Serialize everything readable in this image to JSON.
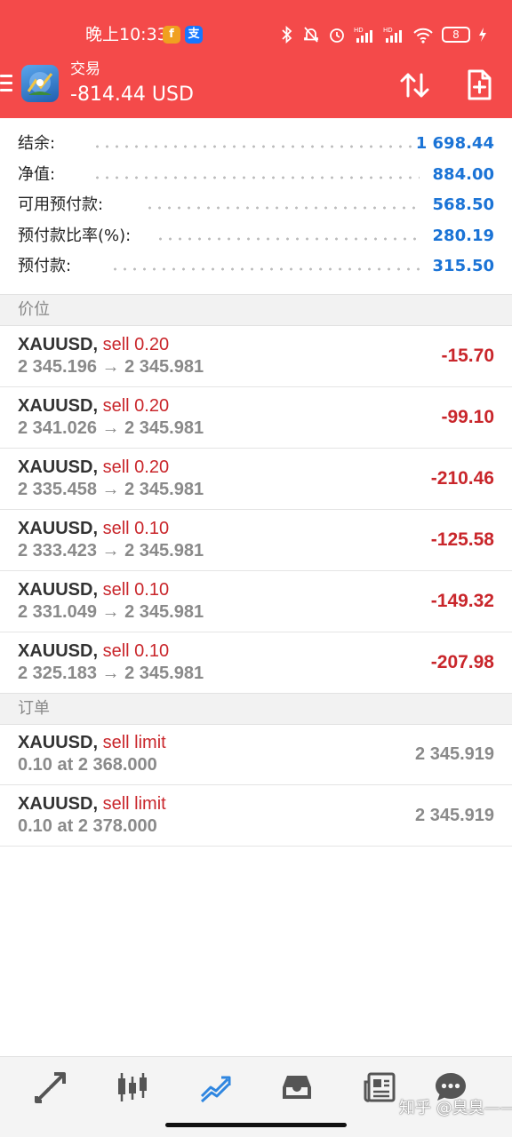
{
  "status_bar": {
    "time": "晚上10:33",
    "app_badges": [
      "f",
      "支"
    ],
    "battery": "8"
  },
  "header": {
    "title": "交易",
    "balance": "-814.44 USD",
    "icons": [
      "menu-icon",
      "metatrader-logo",
      "sort-icon",
      "new-order-icon"
    ]
  },
  "summary": [
    {
      "label": "结余:",
      "value": "1 698.44"
    },
    {
      "label": "净值:",
      "value": "884.00"
    },
    {
      "label": "可用预付款:",
      "value": "568.50"
    },
    {
      "label": "预付款比率(%):",
      "value": "280.19"
    },
    {
      "label": "预付款:",
      "value": "315.50"
    }
  ],
  "positions_section": {
    "title": "价位"
  },
  "positions": [
    {
      "symbol": "XAUUSD,",
      "type": "sell 0.20",
      "prices": "2 345.196 → 2 345.981",
      "profit": "-15.70"
    },
    {
      "symbol": "XAUUSD,",
      "type": "sell 0.20",
      "prices": "2 341.026 → 2 345.981",
      "profit": "-99.10"
    },
    {
      "symbol": "XAUUSD,",
      "type": "sell 0.20",
      "prices": "2 335.458 → 2 345.981",
      "profit": "-210.46"
    },
    {
      "symbol": "XAUUSD,",
      "type": "sell 0.10",
      "prices": "2 333.423 → 2 345.981",
      "profit": "-125.58"
    },
    {
      "symbol": "XAUUSD,",
      "type": "sell 0.10",
      "prices": "2 331.049 → 2 345.981",
      "profit": "-149.32"
    },
    {
      "symbol": "XAUUSD,",
      "type": "sell 0.10",
      "prices": "2 325.183 → 2 345.981",
      "profit": "-207.98"
    }
  ],
  "orders_section": {
    "title": "订单"
  },
  "orders": [
    {
      "symbol": "XAUUSD,",
      "type": "sell limit",
      "details": "0.10 at 2 368.000",
      "price": "2 345.919"
    },
    {
      "symbol": "XAUUSD,",
      "type": "sell limit",
      "details": "0.10 at 2 378.000",
      "price": "2 345.919"
    }
  ],
  "bottom_nav": [
    {
      "name": "quotes",
      "icon": "quotes-arrows-icon",
      "active": false
    },
    {
      "name": "chart",
      "icon": "candlestick-icon",
      "active": false
    },
    {
      "name": "trade",
      "icon": "trade-trend-icon",
      "active": true
    },
    {
      "name": "history",
      "icon": "inbox-history-icon",
      "active": false
    },
    {
      "name": "news",
      "icon": "news-icon",
      "active": false
    },
    {
      "name": "messages",
      "icon": "chat-bubble-icon",
      "active": false
    }
  ],
  "watermark": "知乎 @臭臭——",
  "colors": {
    "header_bg": "#f44a4a",
    "loss_red": "#c9262b",
    "value_blue": "#1a73d6",
    "muted_gray": "#8a8a8a",
    "nav_active": "#2f86e0"
  }
}
